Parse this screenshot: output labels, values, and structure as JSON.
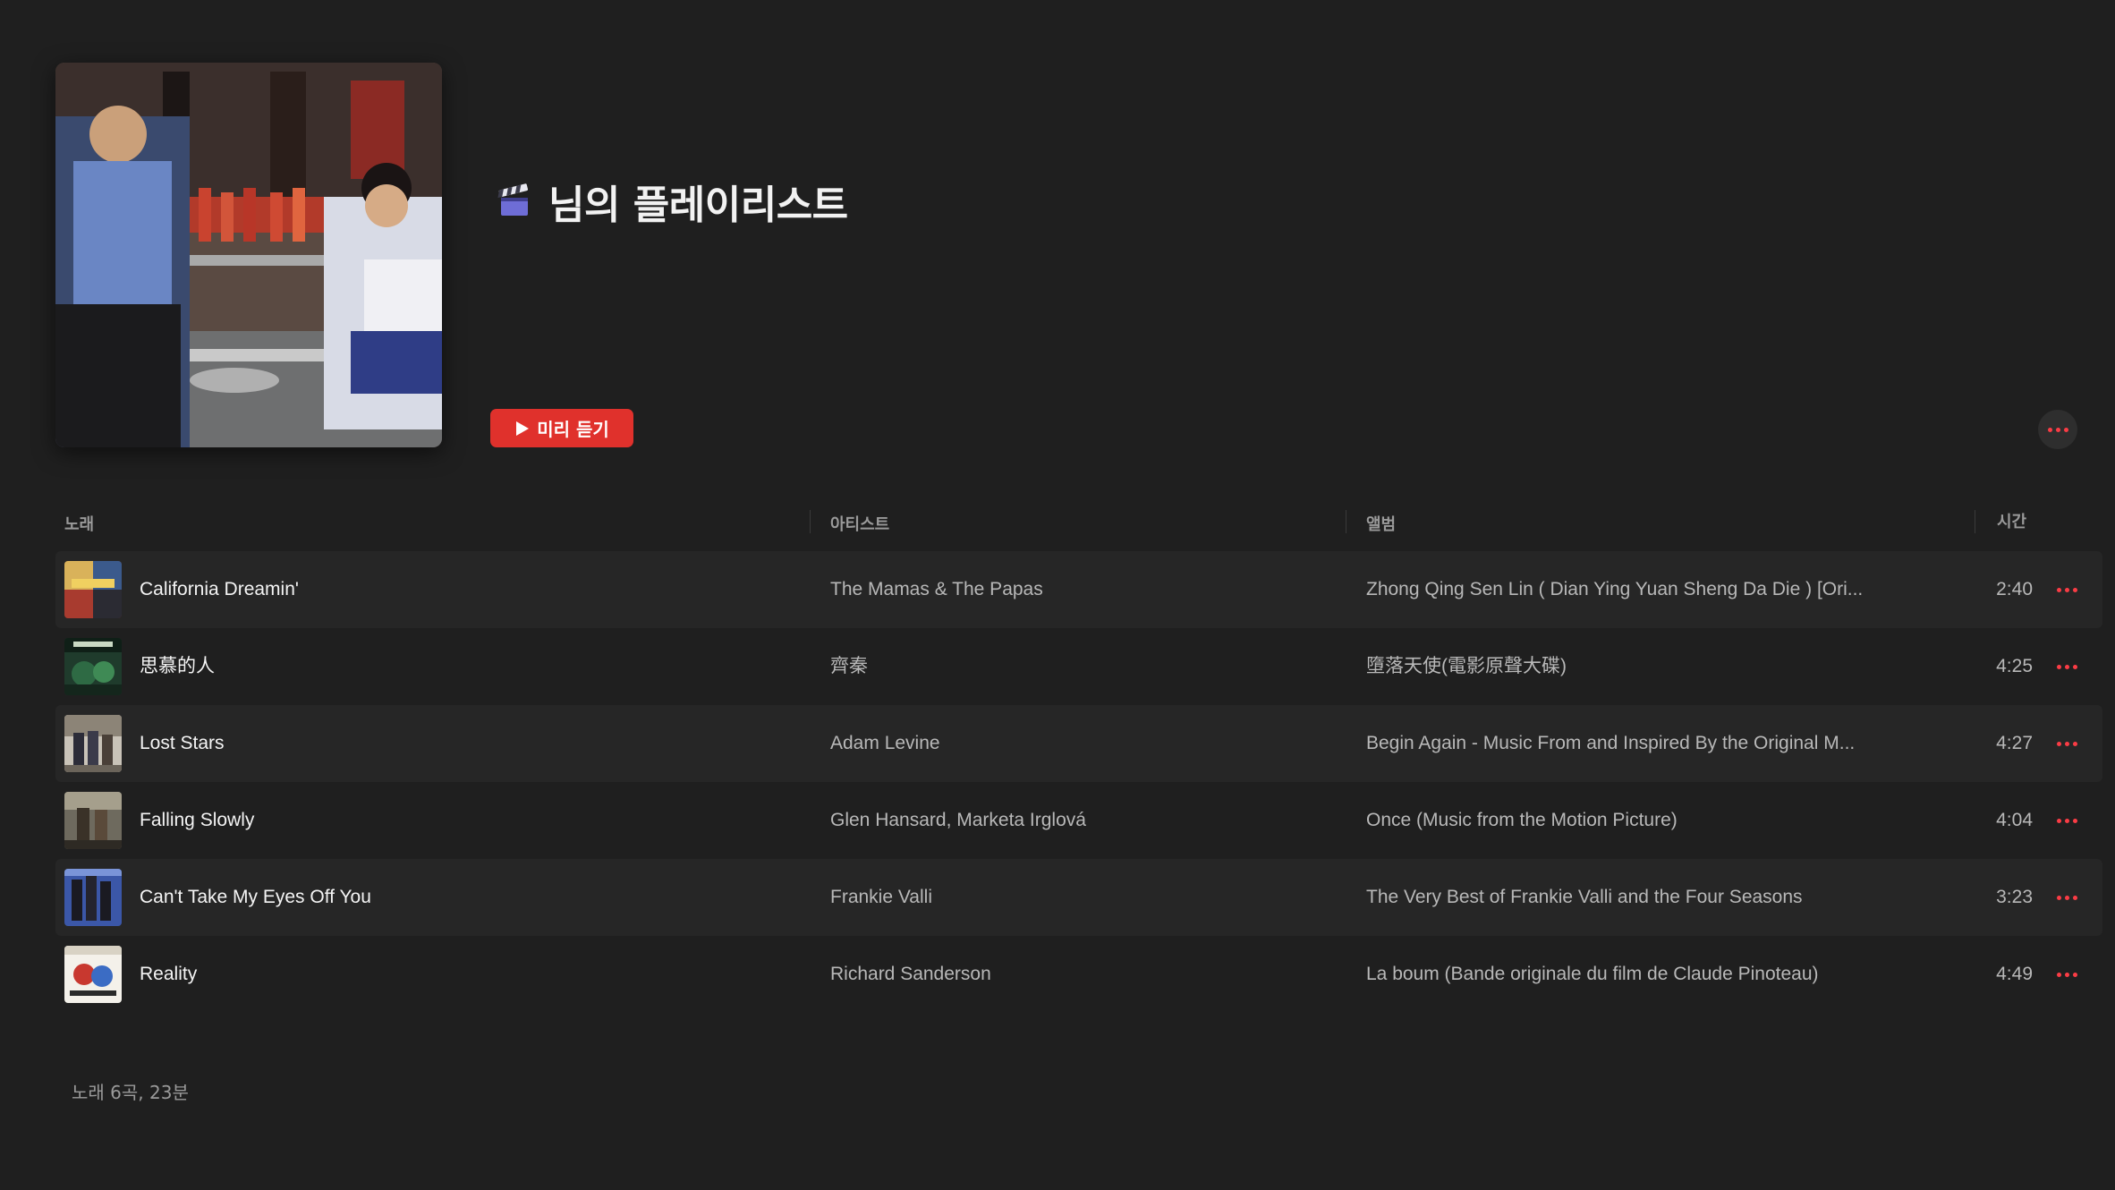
{
  "header": {
    "cover_icon": "playlist-cover-art",
    "title_icon": "clapper-board-icon",
    "title": "님의 플레이리스트",
    "preview_button_label": "미리 듣기",
    "more_icon": "more-icon"
  },
  "colors": {
    "background": "#1f1f1f",
    "accent": "#fa3c45",
    "preview_button": "#e0312c",
    "row_alt": "#262626"
  },
  "table": {
    "headers": {
      "song": "노래",
      "artist": "아티스트",
      "album": "앨범",
      "time": "시간"
    },
    "rows": [
      {
        "song": "California Dreamin'",
        "artist": "The Mamas & The Papas",
        "album": "Zhong Qing Sen Lin ( Dian Ying Yuan Sheng Da Die ) [Ori...",
        "time": "2:40"
      },
      {
        "song": "思慕的人",
        "artist": "齊秦",
        "album": "墮落天使(電影原聲大碟)",
        "time": "4:25"
      },
      {
        "song": "Lost Stars",
        "artist": "Adam Levine",
        "album": "Begin Again - Music From and Inspired By the Original M...",
        "time": "4:27"
      },
      {
        "song": "Falling Slowly",
        "artist": "Glen Hansard, Marketa Irglová",
        "album": "Once (Music from the Motion Picture)",
        "time": "4:04"
      },
      {
        "song": "Can't Take My Eyes Off You",
        "artist": "Frankie Valli",
        "album": "The Very Best of Frankie Valli and the Four Seasons",
        "time": "3:23"
      },
      {
        "song": "Reality",
        "artist": "Richard Sanderson",
        "album": "La boum (Bande originale du film de Claude Pinoteau)",
        "time": "4:49"
      }
    ]
  },
  "footer": {
    "summary": "노래 6곡, 23분"
  }
}
